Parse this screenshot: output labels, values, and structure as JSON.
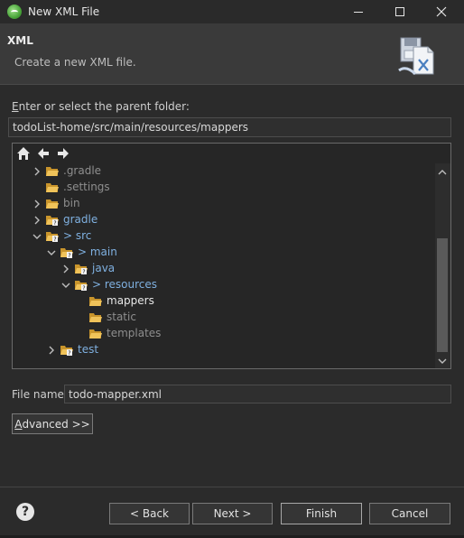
{
  "window": {
    "title": "New XML File"
  },
  "header": {
    "title": "XML",
    "description": "Create a new XML file.",
    "wizard_icon": "xml-file-wizard-icon"
  },
  "parent_folder": {
    "label": "Enter or select the parent folder:",
    "value": "todoList-home/src/main/resources/mappers"
  },
  "tree": {
    "toolbar": [
      "home-icon",
      "back-arrow-icon",
      "forward-arrow-icon"
    ],
    "items": [
      {
        "label": ".gradle",
        "expanded": false,
        "style": "dim"
      },
      {
        "label": ".settings",
        "expanded": null,
        "style": "dim"
      },
      {
        "label": "bin",
        "expanded": false,
        "style": "dim"
      },
      {
        "label": "gradle",
        "expanded": false,
        "style": "blue"
      },
      {
        "label": "> src",
        "expanded": true,
        "style": "blue"
      },
      {
        "label": "> main",
        "expanded": true,
        "style": "blue"
      },
      {
        "label": "java",
        "expanded": false,
        "style": "blue"
      },
      {
        "label": "> resources",
        "expanded": true,
        "style": "blue"
      },
      {
        "label": "mappers",
        "expanded": null,
        "style": "selected"
      },
      {
        "label": "static",
        "expanded": null,
        "style": "dim"
      },
      {
        "label": "templates",
        "expanded": null,
        "style": "dim"
      },
      {
        "label": "test",
        "expanded": false,
        "style": "blue"
      }
    ]
  },
  "file_name": {
    "label": "File name:",
    "value": "todo-mapper.xml"
  },
  "advanced_button": "Advanced >>",
  "footer": {
    "back": "< Back",
    "next": "Next >",
    "finish": "Finish",
    "cancel": "Cancel"
  },
  "colors": {
    "background": "#2b2b2b",
    "header": "#3a3a3a",
    "tree_link": "#7fb0e0",
    "folder": "#e8b84a"
  }
}
